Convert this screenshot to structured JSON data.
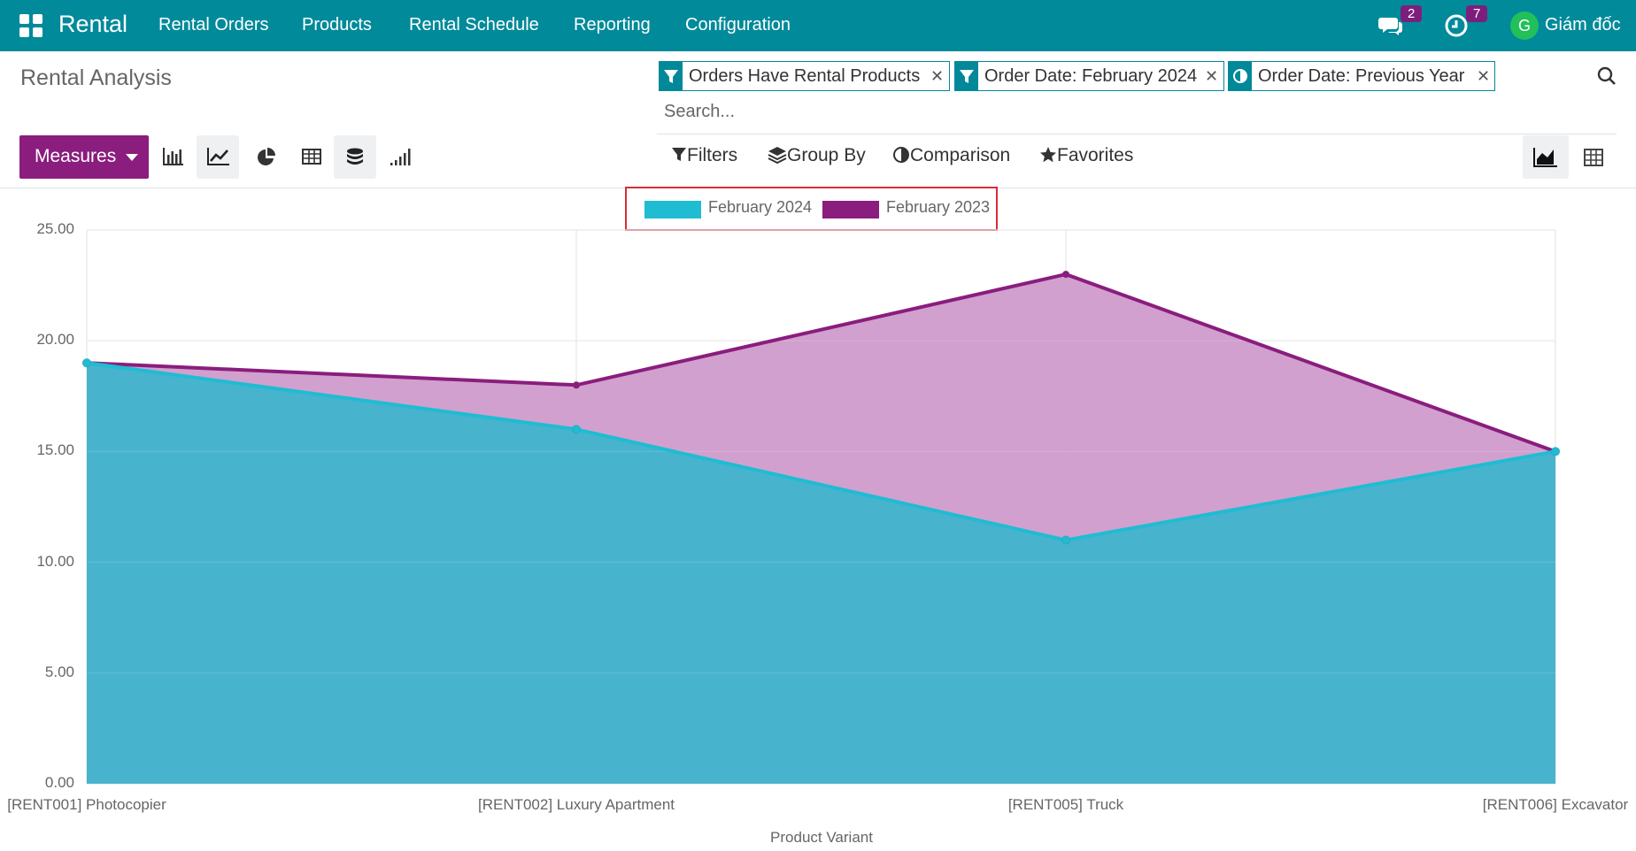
{
  "navbar": {
    "brand": "Rental",
    "menu": [
      "Rental Orders",
      "Products",
      "Rental Schedule",
      "Reporting",
      "Configuration"
    ],
    "messages_count": "2",
    "activities_count": "7",
    "avatar_initial": "G",
    "user_name": "Giám đốc"
  },
  "page": {
    "title": "Rental Analysis"
  },
  "search": {
    "facets": [
      "Orders Have Rental Products",
      "Order Date: February 2024",
      "Order Date: Previous Year"
    ],
    "placeholder": "Search..."
  },
  "toolbar": {
    "measures_label": "Measures",
    "filters": [
      "Filters",
      "Group By",
      "Comparison",
      "Favorites"
    ]
  },
  "colors": {
    "navbar": "#018a9a",
    "measures": "#8a1d7e",
    "series_2024": "#1fbcd2",
    "series_2023": "#8a1d7e"
  },
  "chart_data": {
    "type": "area",
    "categories": [
      "[RENT001] Photocopier",
      "[RENT002] Luxury Apartment",
      "[RENT005] Truck",
      "[RENT006] Excavator"
    ],
    "series": [
      {
        "name": "February 2024",
        "values": [
          19,
          16,
          11,
          15
        ]
      },
      {
        "name": "February 2023",
        "values": [
          19,
          18,
          23,
          15
        ]
      }
    ],
    "yticks": [
      "0.00",
      "5.00",
      "10.00",
      "15.00",
      "20.00",
      "25.00"
    ],
    "ylim": [
      0,
      25
    ],
    "xlabel": "Product Variant",
    "ylabel": "",
    "legend": "top-center",
    "grid": true
  }
}
